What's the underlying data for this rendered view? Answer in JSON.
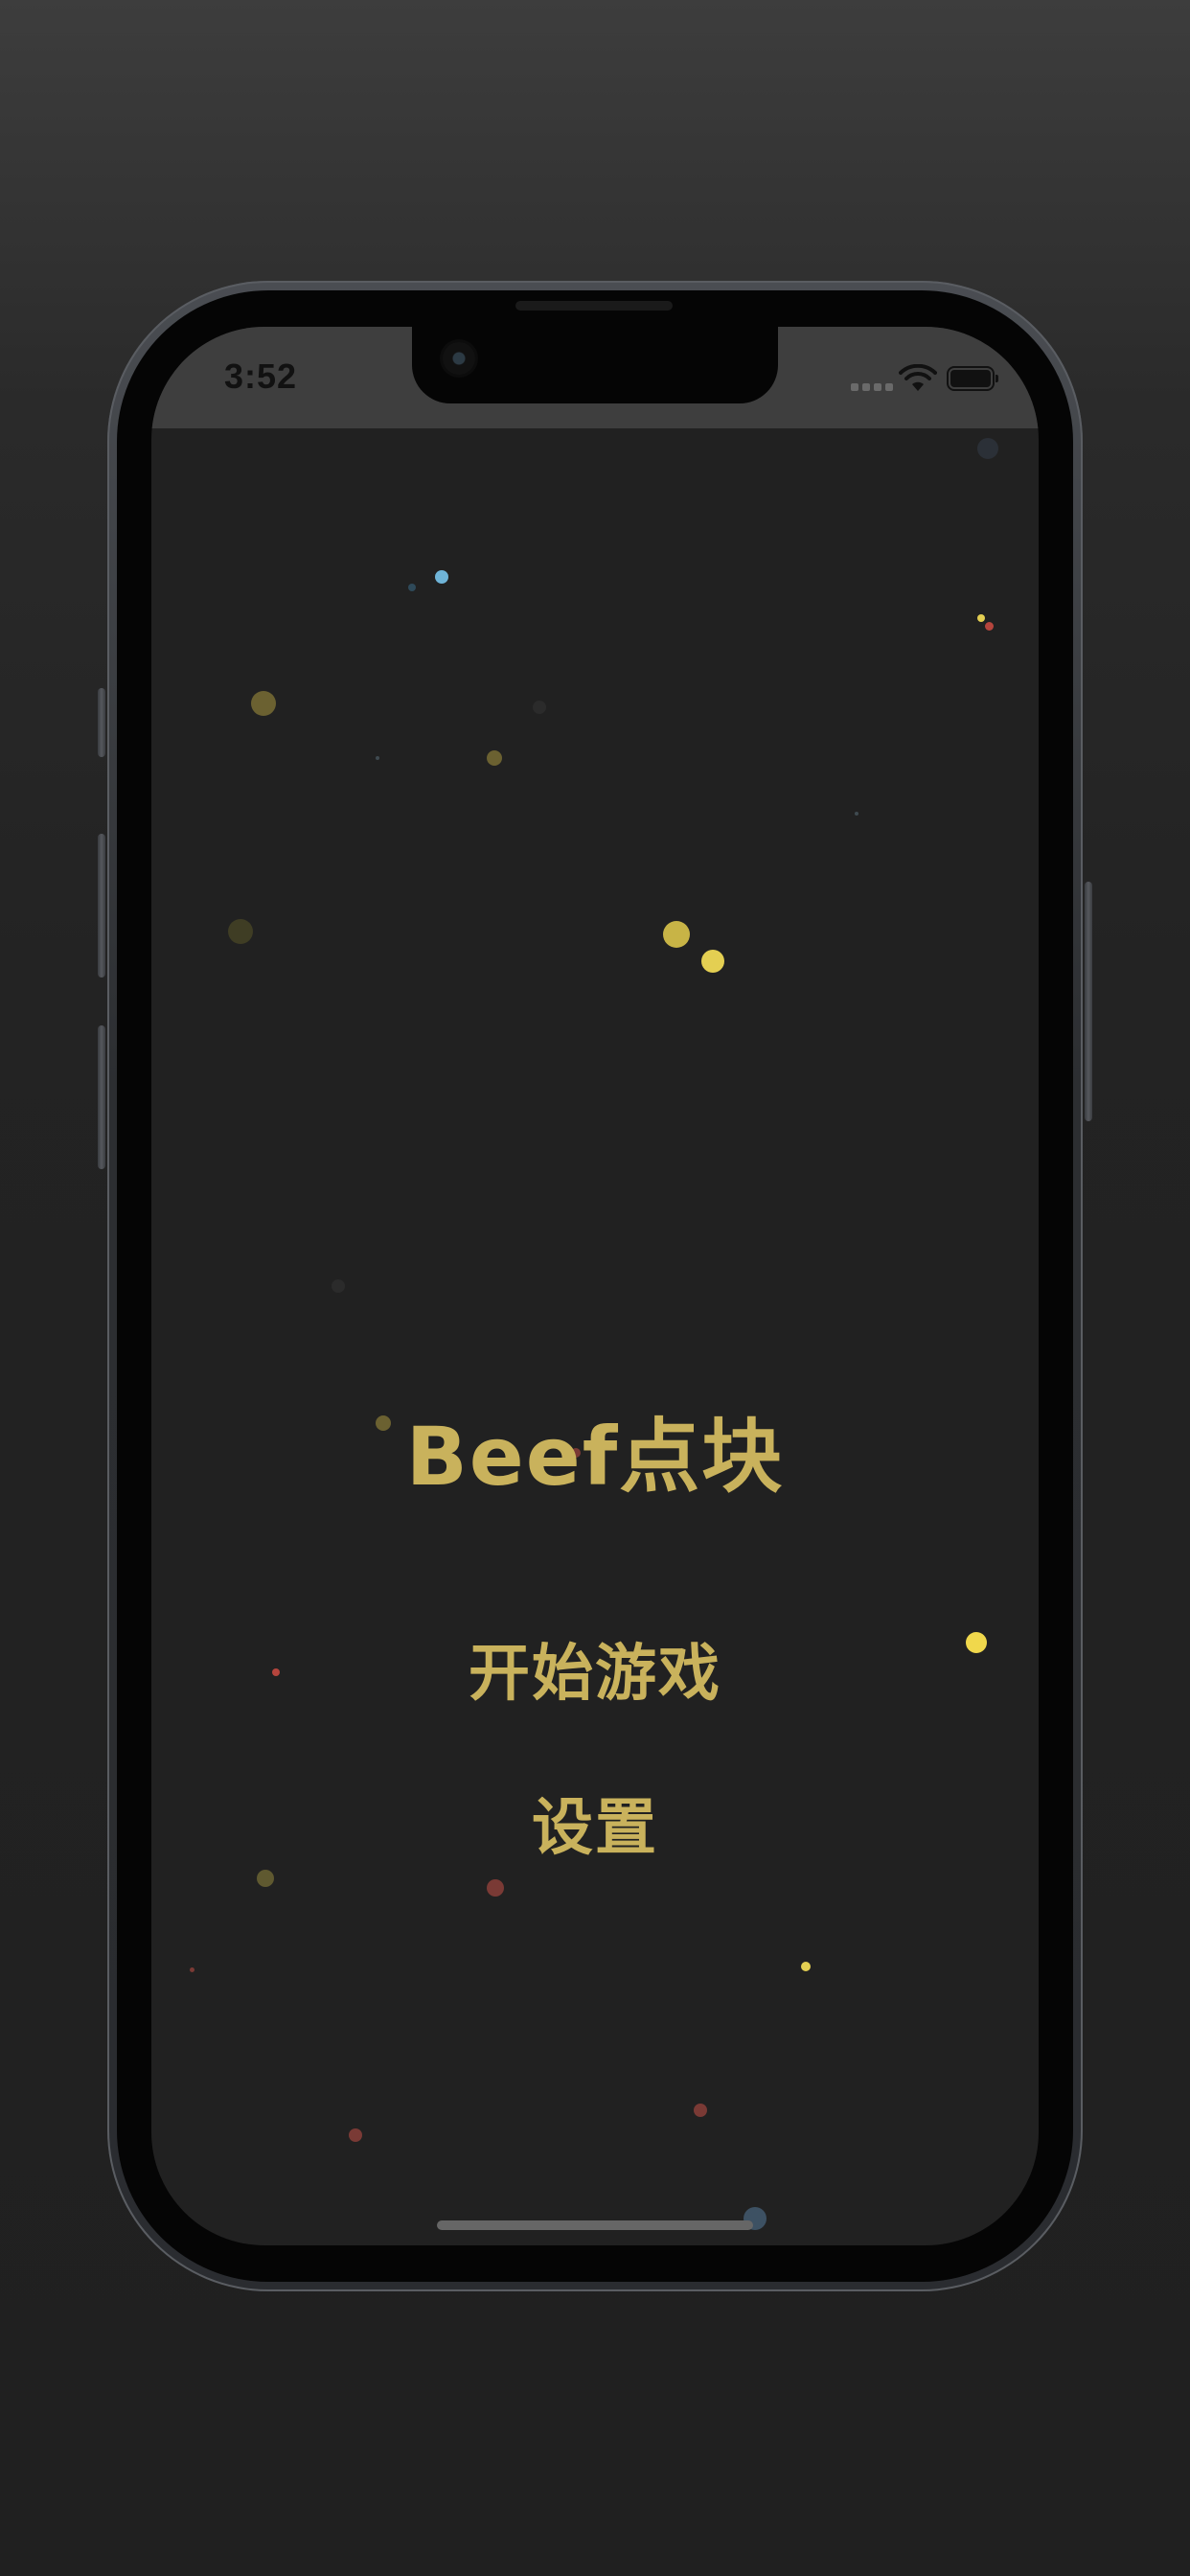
{
  "status_bar": {
    "time": "3:52",
    "wifi_icon": "wifi-icon",
    "battery_icon": "battery-icon",
    "signal_icon": "signal-icon"
  },
  "app": {
    "title": "Beef点块",
    "start_button_label": "开始游戏",
    "settings_button_label": "设置"
  },
  "colors": {
    "background": "#212121",
    "accent": "#c9b25c",
    "particle_yellow": "#e4cf52",
    "particle_blue": "#6fb4d8",
    "particle_red": "#b5453d",
    "status_bar": "#3e3e3e"
  }
}
